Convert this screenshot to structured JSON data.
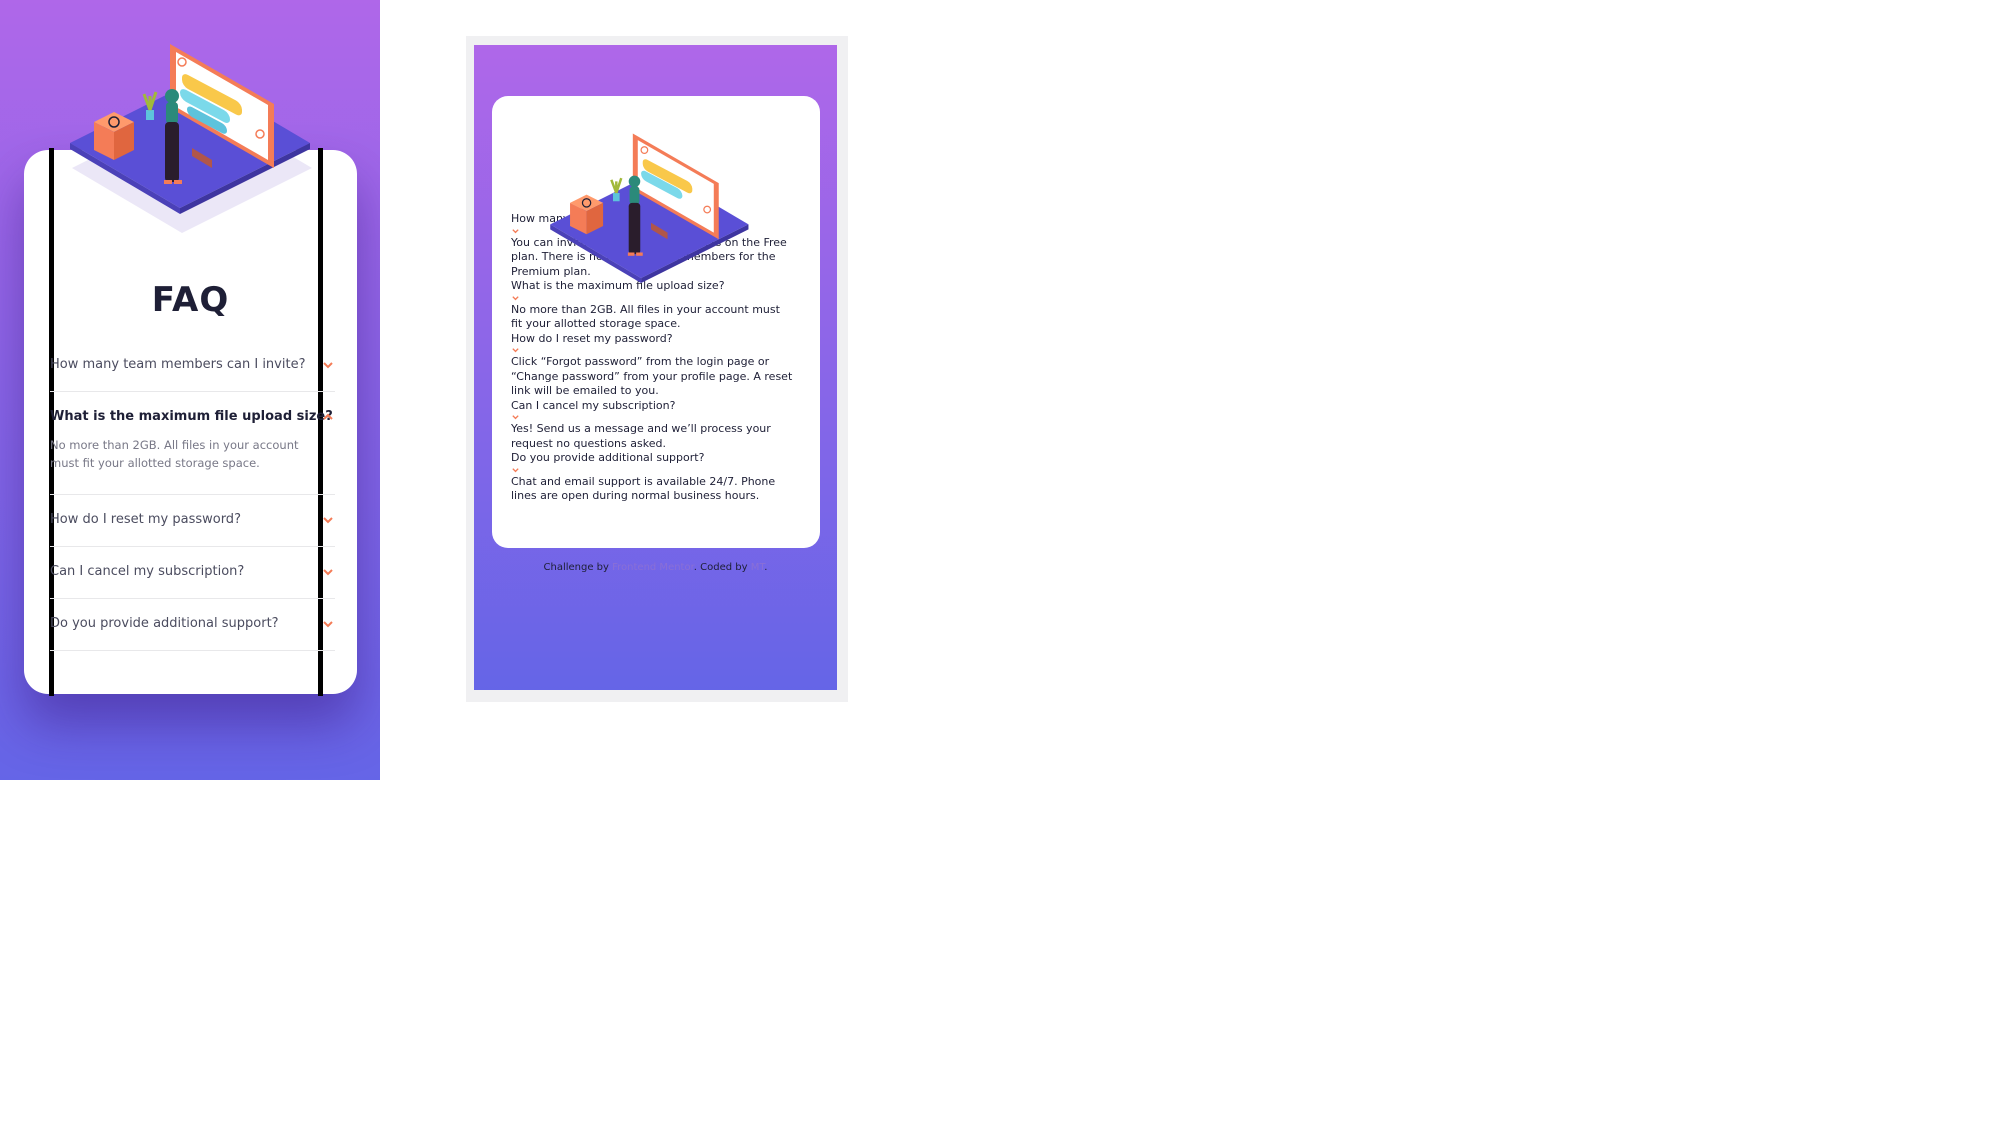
{
  "left": {
    "title": "FAQ",
    "items": [
      {
        "question": "How many team members can I invite?",
        "open": false
      },
      {
        "question": "What is the maximum file upload size?",
        "open": true,
        "answer": "No more than 2GB. All files in your account must fit your allotted storage space."
      },
      {
        "question": "How do I reset my password?",
        "open": false
      },
      {
        "question": "Can I cancel my subscription?",
        "open": false
      },
      {
        "question": "Do you provide additional support?",
        "open": false
      }
    ]
  },
  "right": {
    "items": [
      {
        "question": "How many team members can I invite?",
        "answer": "You can invite up to 2 additional users on the Free plan. There is no limit on team members for the Premium plan."
      },
      {
        "question": "What is the maximum file upload size?",
        "answer": "No more than 2GB. All files in your account must fit your allotted storage space."
      },
      {
        "question": "How do I reset my password?",
        "answer": "Click “Forgot password” from the login page or “Change password” from your profile page. A reset link will be emailed to you."
      },
      {
        "question": "Can I cancel my subscription?",
        "answer": "Yes! Send us a message and we’ll process your request no questions asked."
      },
      {
        "question": "Do you provide additional support?",
        "answer": "Chat and email support is available 24/7. Phone lines are open during normal business hours."
      }
    ],
    "footer": {
      "prefix": "Challenge by ",
      "link1": "Frontend Mentor",
      "middle": ". Coded by ",
      "link2": "MT",
      "suffix": "."
    }
  },
  "colors": {
    "gradient_top": "#af67e9",
    "gradient_bottom": "#6565e7",
    "accent": "#f47c57",
    "text_dark": "#1e1f36"
  }
}
